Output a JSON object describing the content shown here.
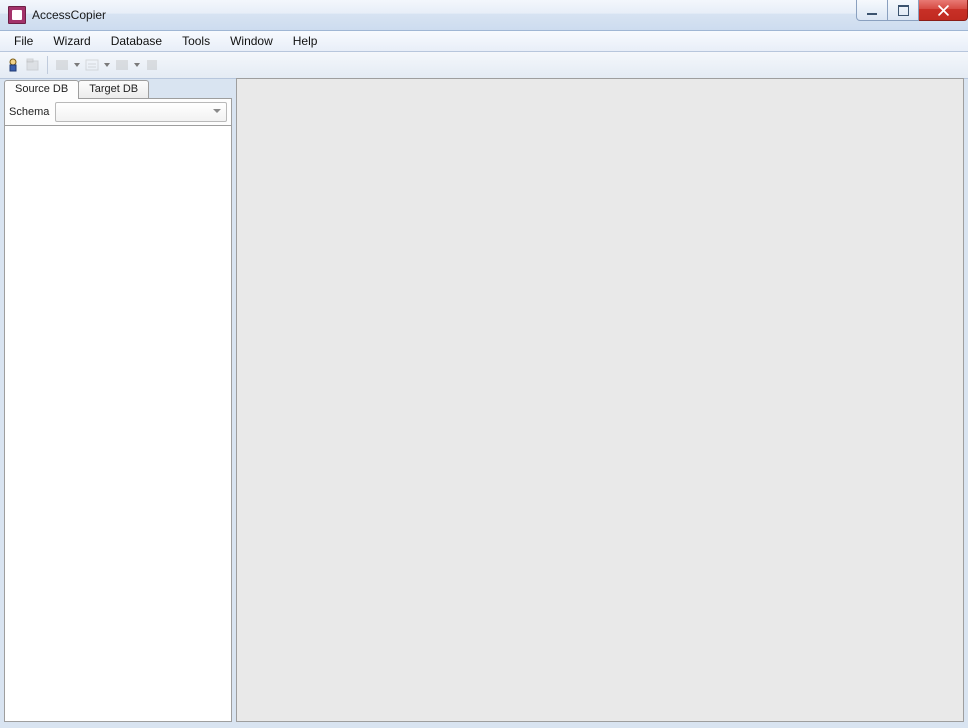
{
  "window": {
    "title": "AccessCopier"
  },
  "menu": {
    "items": [
      "File",
      "Wizard",
      "Database",
      "Tools",
      "Window",
      "Help"
    ]
  },
  "sidebar": {
    "tabs": [
      {
        "label": "Source DB",
        "active": true
      },
      {
        "label": "Target DB",
        "active": false
      }
    ],
    "schema_label": "Schema",
    "schema_value": ""
  }
}
